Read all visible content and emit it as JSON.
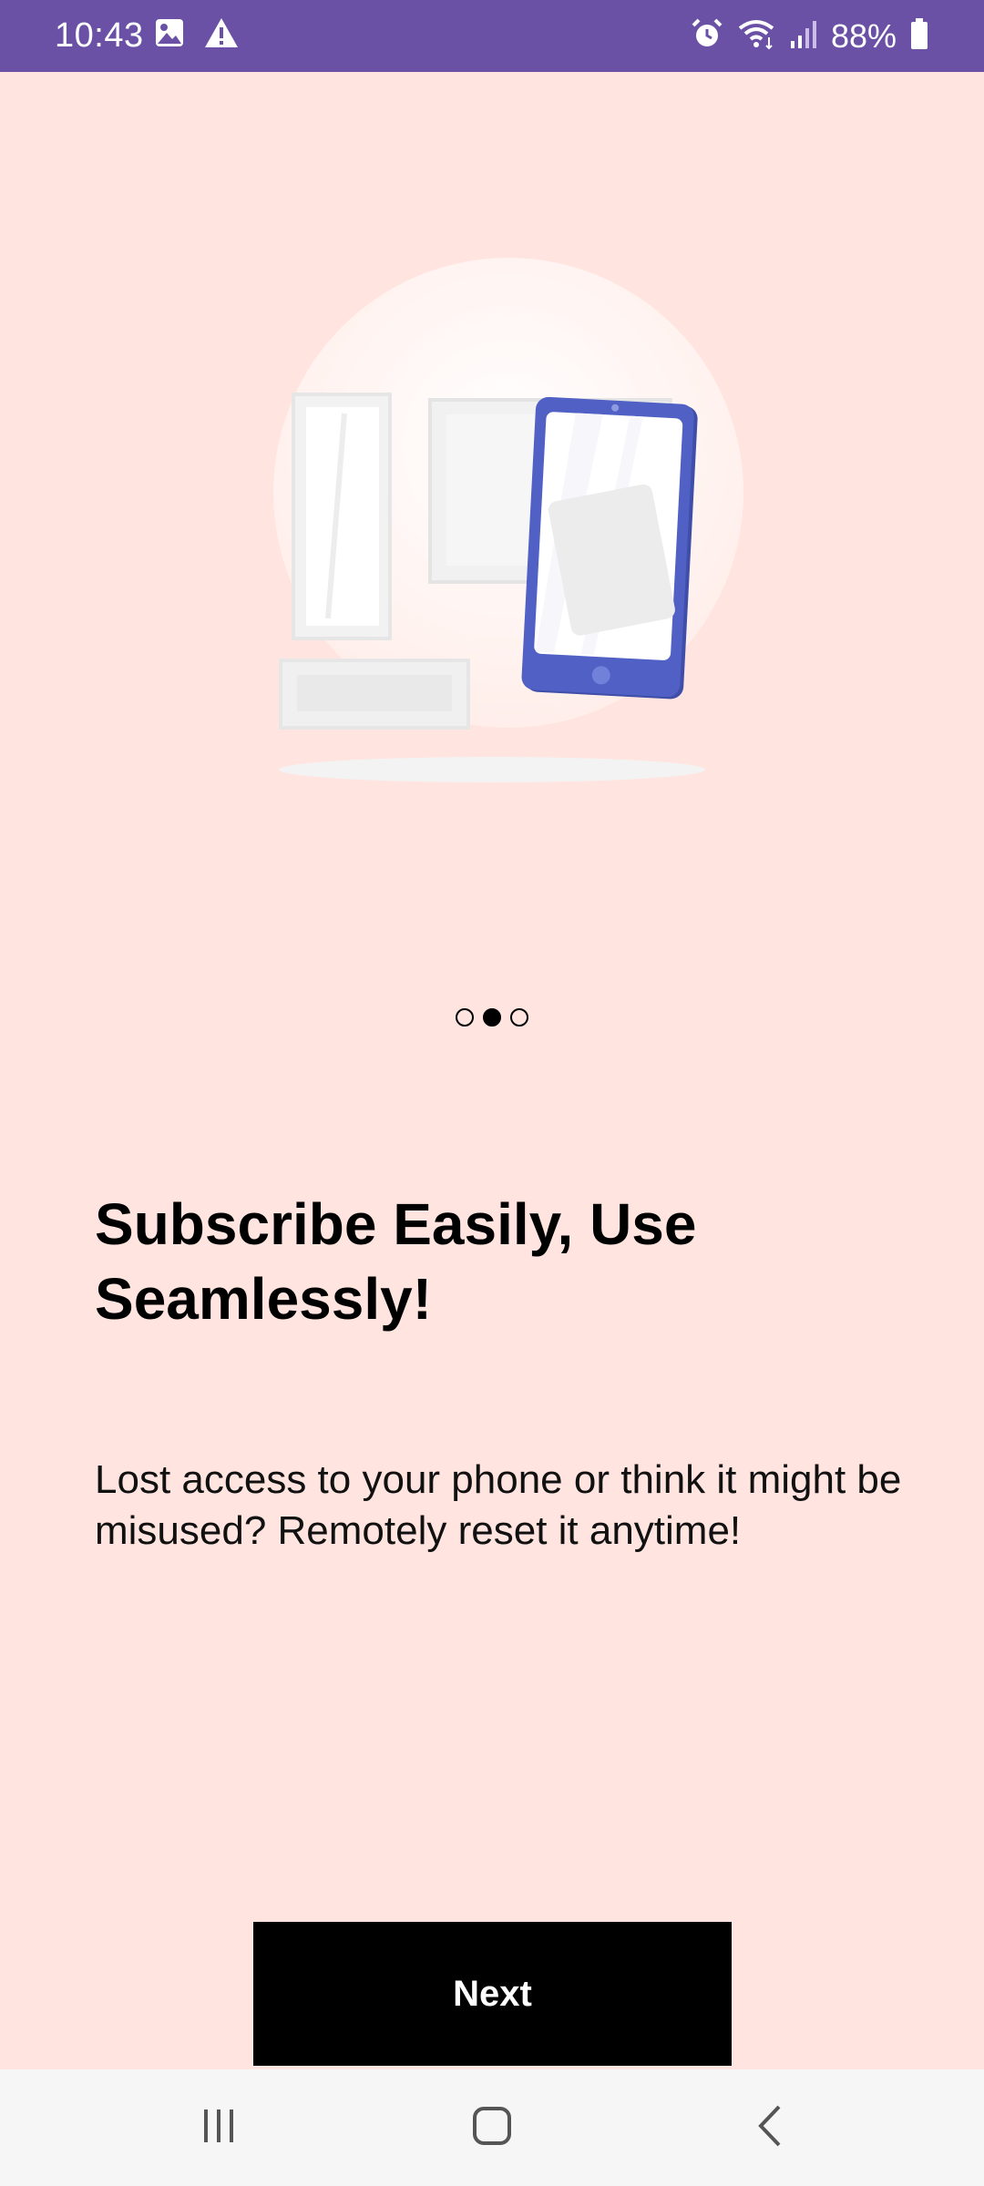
{
  "status_bar": {
    "time": "10:43",
    "battery": "88%",
    "left_icons": [
      "image-icon",
      "warning-icon"
    ],
    "right_icons": [
      "alarm-icon",
      "wifi-icon",
      "signal-icon",
      "battery-icon"
    ],
    "background": "#6a51a6"
  },
  "onboarding": {
    "page_indicator": {
      "total": 3,
      "active": 2
    },
    "title": "Subscribe Easily, Use Seamlessly!",
    "description": "Lost access to your phone or think it might be misused? Remotely reset it anytime!",
    "next_label": "Next",
    "illustration": "phone-illustration"
  },
  "nav_bar": {
    "buttons": [
      "recents-icon",
      "home-icon",
      "back-icon"
    ]
  },
  "colors": {
    "background": "#ffe4df",
    "phone_accent": "#5160c4",
    "button": "#000000"
  }
}
